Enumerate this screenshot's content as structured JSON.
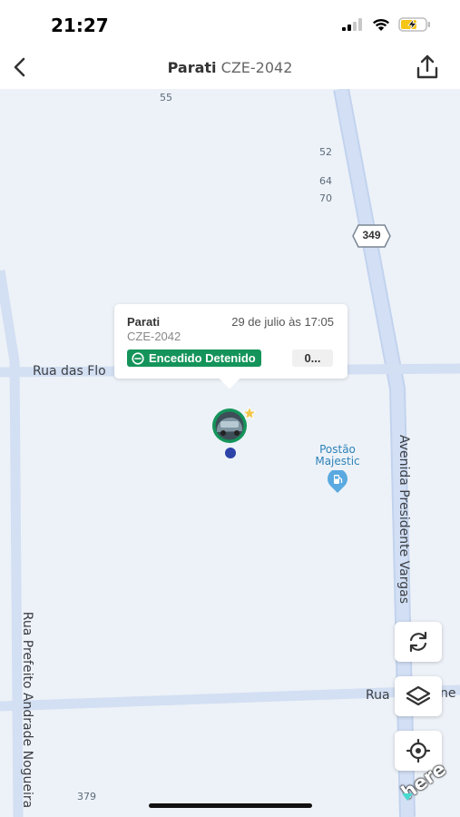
{
  "status_bar": {
    "time": "21:27",
    "icons": [
      "cellular-signal-icon",
      "wifi-icon",
      "battery-charging-icon"
    ],
    "battery_color": "#f5c518"
  },
  "nav": {
    "title_name": "Parati",
    "title_plate": "CZE-2042",
    "back_icon": "chevron-left-icon",
    "share_icon": "share-icon"
  },
  "map": {
    "numbers": [
      "55",
      "52",
      "64",
      "70",
      "379"
    ],
    "route_shield": "349",
    "streets": {
      "flores": "Rua das Flo",
      "vargas": "Avenida Presidente Vargas",
      "prefeito": "Rua Prefeito Andrade Nogueira",
      "bottom_left": "Rua",
      "bottom_right": "ne"
    },
    "poi": {
      "line1": "Postão",
      "line2": "Majestic",
      "icon": "fuel-station-icon"
    },
    "colors": {
      "background": "#edf2f8",
      "major_road": "#c9d9f2",
      "minor_road": "#d4e0f3"
    }
  },
  "popup": {
    "name": "Parati",
    "date": "29 de julio às 17:05",
    "plate": "CZE-2042",
    "status": "Encedido Detenido",
    "status_color": "#14945a",
    "speed": "0..."
  },
  "marker": {
    "icon": "vehicle-photo-icon",
    "favorite_icon": "star-icon",
    "ring_color": "#14945a"
  },
  "controls": [
    "refresh-icon",
    "layers-icon",
    "locate-icon"
  ],
  "attribution": "here"
}
